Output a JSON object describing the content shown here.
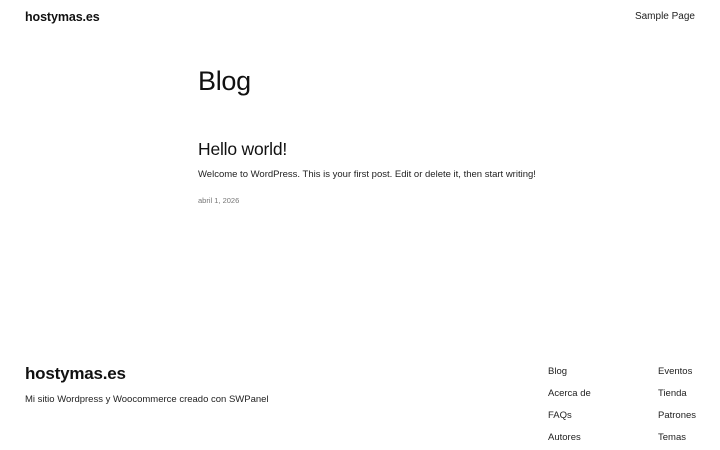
{
  "header": {
    "site_title": "hostymas.es",
    "nav": [
      "Sample Page"
    ]
  },
  "main": {
    "heading": "Blog",
    "posts": [
      {
        "title": "Hello world!",
        "excerpt": "Welcome to WordPress. This is your first post. Edit or delete it, then start writing!",
        "date": "abril 1, 2026"
      }
    ]
  },
  "footer": {
    "site_title": "hostymas.es",
    "tagline": "Mi sitio Wordpress y Woocommerce creado con SWPanel",
    "links_col1": [
      "Blog",
      "Acerca de",
      "FAQs",
      "Autores"
    ],
    "links_col2": [
      "Eventos",
      "Tienda",
      "Patrones",
      "Temas"
    ]
  }
}
